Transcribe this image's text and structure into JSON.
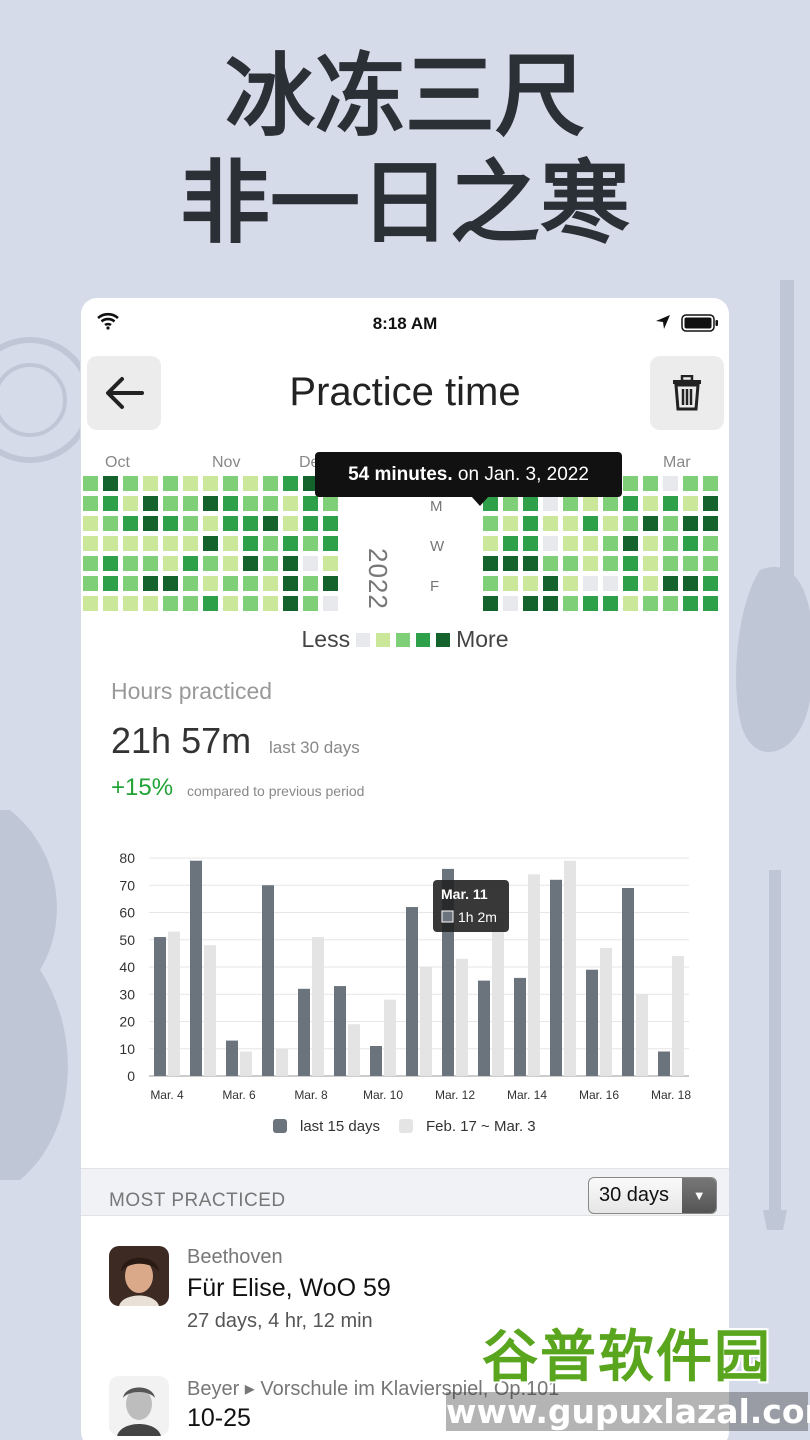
{
  "headline": {
    "line1": "冰冻三尺",
    "line2": "非一日之寒"
  },
  "status_bar": {
    "time": "8:18 AM"
  },
  "nav": {
    "title": "Practice time",
    "back_icon": "arrow-left-icon",
    "delete_icon": "trash-icon"
  },
  "heatmap": {
    "months": [
      "Oct",
      "Nov",
      "Dec",
      "Mar"
    ],
    "year": "2022",
    "weekdays": [
      "M",
      "W",
      "F"
    ],
    "tooltip_bold": "54 minutes.",
    "tooltip_rest": " on Jan. 3, 2022",
    "legend_less": "Less",
    "legend_more": "More",
    "colors": [
      "#e8e9ec",
      "#cbe79a",
      "#7fce78",
      "#2ea04a",
      "#14632c"
    ]
  },
  "stats": {
    "label": "Hours practiced",
    "value": "21h 57m",
    "period": "last 30 days",
    "change": "+15%",
    "change_text": "compared to previous period"
  },
  "chart_data": {
    "type": "bar",
    "categories": [
      "Mar. 4",
      "Mar. 5",
      "Mar. 6",
      "Mar. 7",
      "Mar. 8",
      "Mar. 9",
      "Mar. 10",
      "Mar. 11",
      "Mar. 12",
      "Mar. 13",
      "Mar. 14",
      "Mar. 15",
      "Mar. 16",
      "Mar. 17",
      "Mar. 18"
    ],
    "tick_labels": [
      "Mar. 4",
      "Mar. 6",
      "Mar. 8",
      "Mar. 10",
      "Mar. 12",
      "Mar. 14",
      "Mar. 16",
      "Mar. 18"
    ],
    "y_ticks": [
      0,
      10,
      20,
      30,
      40,
      50,
      60,
      70,
      80
    ],
    "ylim": [
      0,
      80
    ],
    "series": [
      {
        "name": "last 15 days",
        "color": "#6b737d",
        "values": [
          51,
          79,
          13,
          70,
          32,
          33,
          11,
          62,
          76,
          35,
          36,
          72,
          39,
          69,
          9
        ]
      },
      {
        "name": "Feb. 17 ~ Mar. 3",
        "color": "#e4e4e4",
        "values": [
          53,
          48,
          9,
          10,
          51,
          19,
          28,
          40,
          43,
          58,
          74,
          79,
          47,
          30,
          44
        ]
      }
    ],
    "tooltip": {
      "title": "Mar. 11",
      "value": "1h 2m"
    },
    "grid": true,
    "legend": "bottom"
  },
  "most_practiced": {
    "title": "MOST PRACTICED",
    "range": "30 days",
    "items": [
      {
        "composer": "Beethoven",
        "title": "Für Elise, WoO 59",
        "detail": "27 days, 4 hr, 12 min"
      },
      {
        "composer": "Beyer ▸ Vorschule im Klavierspiel, Op.101",
        "title": "10-25",
        "detail": ""
      }
    ]
  },
  "watermark": {
    "cn": "谷普软件园",
    "en": "www.gupuxlazal.com"
  }
}
